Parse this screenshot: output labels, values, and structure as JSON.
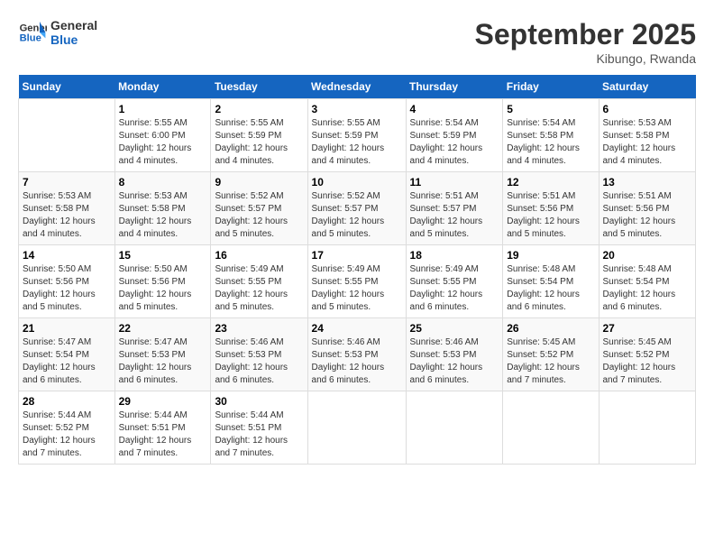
{
  "logo": {
    "line1": "General",
    "line2": "Blue"
  },
  "title": "September 2025",
  "location": "Kibungo, Rwanda",
  "days_of_week": [
    "Sunday",
    "Monday",
    "Tuesday",
    "Wednesday",
    "Thursday",
    "Friday",
    "Saturday"
  ],
  "weeks": [
    [
      {
        "day": "",
        "info": ""
      },
      {
        "day": "1",
        "info": "Sunrise: 5:55 AM\nSunset: 6:00 PM\nDaylight: 12 hours\nand 4 minutes."
      },
      {
        "day": "2",
        "info": "Sunrise: 5:55 AM\nSunset: 5:59 PM\nDaylight: 12 hours\nand 4 minutes."
      },
      {
        "day": "3",
        "info": "Sunrise: 5:55 AM\nSunset: 5:59 PM\nDaylight: 12 hours\nand 4 minutes."
      },
      {
        "day": "4",
        "info": "Sunrise: 5:54 AM\nSunset: 5:59 PM\nDaylight: 12 hours\nand 4 minutes."
      },
      {
        "day": "5",
        "info": "Sunrise: 5:54 AM\nSunset: 5:58 PM\nDaylight: 12 hours\nand 4 minutes."
      },
      {
        "day": "6",
        "info": "Sunrise: 5:53 AM\nSunset: 5:58 PM\nDaylight: 12 hours\nand 4 minutes."
      }
    ],
    [
      {
        "day": "7",
        "info": "Sunrise: 5:53 AM\nSunset: 5:58 PM\nDaylight: 12 hours\nand 4 minutes."
      },
      {
        "day": "8",
        "info": "Sunrise: 5:53 AM\nSunset: 5:58 PM\nDaylight: 12 hours\nand 4 minutes."
      },
      {
        "day": "9",
        "info": "Sunrise: 5:52 AM\nSunset: 5:57 PM\nDaylight: 12 hours\nand 5 minutes."
      },
      {
        "day": "10",
        "info": "Sunrise: 5:52 AM\nSunset: 5:57 PM\nDaylight: 12 hours\nand 5 minutes."
      },
      {
        "day": "11",
        "info": "Sunrise: 5:51 AM\nSunset: 5:57 PM\nDaylight: 12 hours\nand 5 minutes."
      },
      {
        "day": "12",
        "info": "Sunrise: 5:51 AM\nSunset: 5:56 PM\nDaylight: 12 hours\nand 5 minutes."
      },
      {
        "day": "13",
        "info": "Sunrise: 5:51 AM\nSunset: 5:56 PM\nDaylight: 12 hours\nand 5 minutes."
      }
    ],
    [
      {
        "day": "14",
        "info": "Sunrise: 5:50 AM\nSunset: 5:56 PM\nDaylight: 12 hours\nand 5 minutes."
      },
      {
        "day": "15",
        "info": "Sunrise: 5:50 AM\nSunset: 5:56 PM\nDaylight: 12 hours\nand 5 minutes."
      },
      {
        "day": "16",
        "info": "Sunrise: 5:49 AM\nSunset: 5:55 PM\nDaylight: 12 hours\nand 5 minutes."
      },
      {
        "day": "17",
        "info": "Sunrise: 5:49 AM\nSunset: 5:55 PM\nDaylight: 12 hours\nand 5 minutes."
      },
      {
        "day": "18",
        "info": "Sunrise: 5:49 AM\nSunset: 5:55 PM\nDaylight: 12 hours\nand 6 minutes."
      },
      {
        "day": "19",
        "info": "Sunrise: 5:48 AM\nSunset: 5:54 PM\nDaylight: 12 hours\nand 6 minutes."
      },
      {
        "day": "20",
        "info": "Sunrise: 5:48 AM\nSunset: 5:54 PM\nDaylight: 12 hours\nand 6 minutes."
      }
    ],
    [
      {
        "day": "21",
        "info": "Sunrise: 5:47 AM\nSunset: 5:54 PM\nDaylight: 12 hours\nand 6 minutes."
      },
      {
        "day": "22",
        "info": "Sunrise: 5:47 AM\nSunset: 5:53 PM\nDaylight: 12 hours\nand 6 minutes."
      },
      {
        "day": "23",
        "info": "Sunrise: 5:46 AM\nSunset: 5:53 PM\nDaylight: 12 hours\nand 6 minutes."
      },
      {
        "day": "24",
        "info": "Sunrise: 5:46 AM\nSunset: 5:53 PM\nDaylight: 12 hours\nand 6 minutes."
      },
      {
        "day": "25",
        "info": "Sunrise: 5:46 AM\nSunset: 5:53 PM\nDaylight: 12 hours\nand 6 minutes."
      },
      {
        "day": "26",
        "info": "Sunrise: 5:45 AM\nSunset: 5:52 PM\nDaylight: 12 hours\nand 7 minutes."
      },
      {
        "day": "27",
        "info": "Sunrise: 5:45 AM\nSunset: 5:52 PM\nDaylight: 12 hours\nand 7 minutes."
      }
    ],
    [
      {
        "day": "28",
        "info": "Sunrise: 5:44 AM\nSunset: 5:52 PM\nDaylight: 12 hours\nand 7 minutes."
      },
      {
        "day": "29",
        "info": "Sunrise: 5:44 AM\nSunset: 5:51 PM\nDaylight: 12 hours\nand 7 minutes."
      },
      {
        "day": "30",
        "info": "Sunrise: 5:44 AM\nSunset: 5:51 PM\nDaylight: 12 hours\nand 7 minutes."
      },
      {
        "day": "",
        "info": ""
      },
      {
        "day": "",
        "info": ""
      },
      {
        "day": "",
        "info": ""
      },
      {
        "day": "",
        "info": ""
      }
    ]
  ]
}
